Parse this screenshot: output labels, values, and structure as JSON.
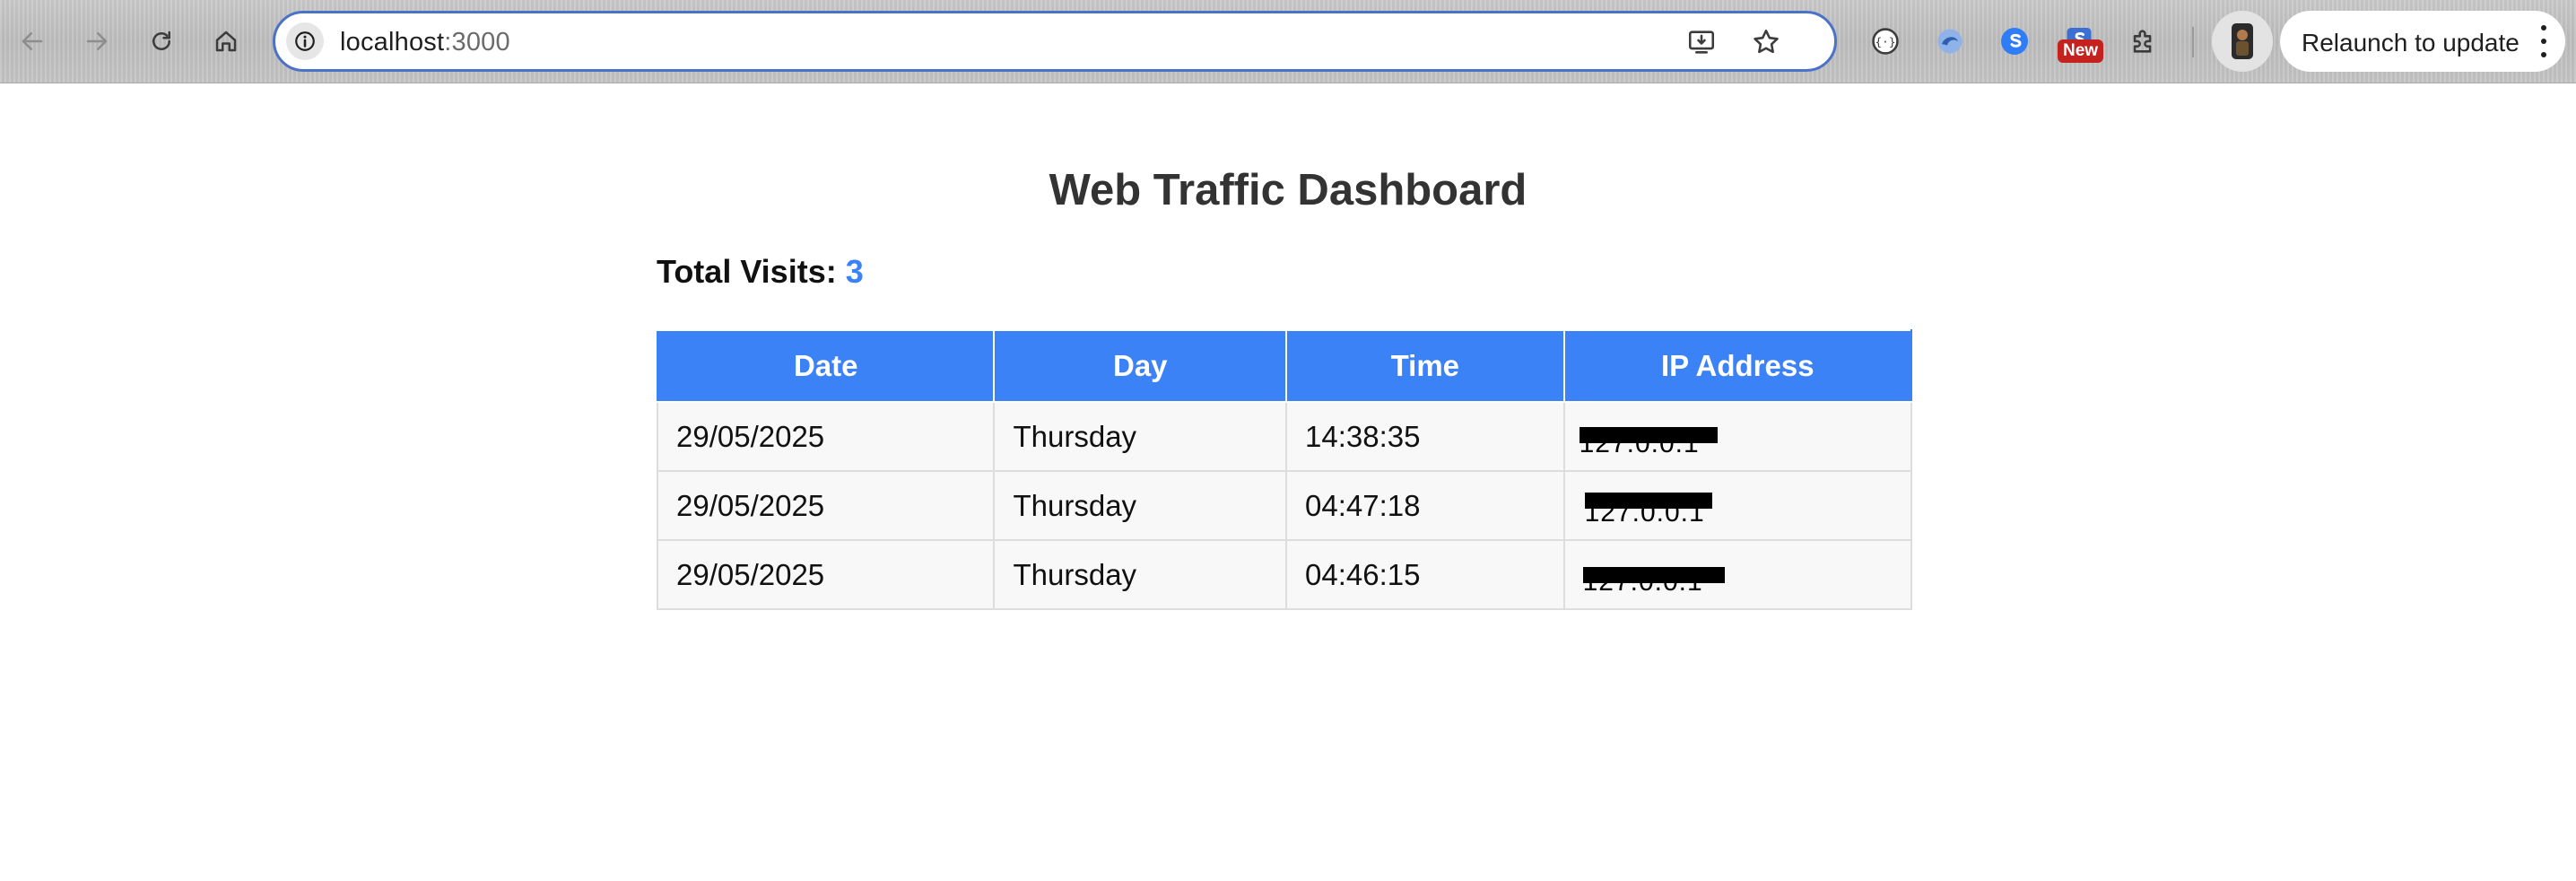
{
  "browser": {
    "url_host": "localhost",
    "url_port": ":3000",
    "relaunch_label": "Relaunch to update",
    "new_badge": "New",
    "accent_color": "#4a72c9",
    "icons": [
      "back-arrow-icon",
      "forward-arrow-icon",
      "reload-icon",
      "home-icon",
      "site-info-icon",
      "install-app-icon",
      "bookmark-star-icon",
      "extension-icon",
      "puzzle-icon",
      "kebab-menu-icon"
    ]
  },
  "page": {
    "title": "Web Traffic Dashboard",
    "total_visits_label": "Total Visits:",
    "total_visits_value": "3",
    "accent_color": "#3b82f6"
  },
  "table": {
    "headers": [
      "Date",
      "Day",
      "Time",
      "IP Address"
    ],
    "rows": [
      {
        "date": "29/05/2025",
        "day": "Thursday",
        "time": "14:38:35",
        "ip": "127.0.0.1"
      },
      {
        "date": "29/05/2025",
        "day": "Thursday",
        "time": "04:47:18",
        "ip": "127.0.0.1"
      },
      {
        "date": "29/05/2025",
        "day": "Thursday",
        "time": "04:46:15",
        "ip": "127.0.0.1"
      }
    ]
  }
}
